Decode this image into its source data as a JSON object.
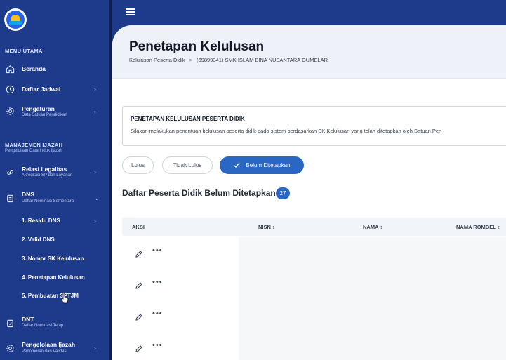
{
  "sidebar": {
    "section_main": "MENU UTAMA",
    "items_main": [
      {
        "label": "Beranda",
        "sub": ""
      },
      {
        "label": "Daftar Jadwal",
        "sub": ""
      },
      {
        "label": "Pengaturan",
        "sub": "Data Satuan Pendidikan"
      }
    ],
    "section_ijazah": "MANAJEMEN IJAZAH",
    "section_ijazah_sub": "Pengelolaan Data Induk Ijazah",
    "items_ijazah": [
      {
        "label": "Relasi Legalitas",
        "sub": "Akreditasi SP dan Layanan"
      },
      {
        "label": "DNS",
        "sub": "Daftar Nominasi Sementara"
      },
      {
        "label": "DNT",
        "sub": "Daftar Nominasi Tetap"
      },
      {
        "label": "Pengelolaan Ijazah",
        "sub": "Penomoran dan Validasi"
      }
    ],
    "dns_subitems": [
      "1. Residu DNS",
      "2. Valid DNS",
      "3. Nomor SK Kelulusan",
      "4. Penetapan Kelulusan",
      "5. Pembuatan SPTJM"
    ]
  },
  "header": {
    "title": "Penetapan Kelulusan",
    "breadcrumb": [
      "Kelulusan Peserta Didik",
      "(69899341) SMK ISLAM BINA NUSANTARA GUMELAR"
    ]
  },
  "info": {
    "title": "PENETAPAN KELULUSAN PESERTA DIDIK",
    "text": "Silakan melakukan penentuan kelulusan peserta didik pada sistem berdasarkan SK Kelulusan yang telah ditetapkan oleh Satuan Pen"
  },
  "filters": {
    "lulus": "Lulus",
    "tidak_lulus": "Tidak Lulus",
    "belum": "Belum Ditetapkan"
  },
  "list": {
    "title": "Daftar Peserta Didik Belum Ditetapkan",
    "count": "27"
  },
  "table": {
    "columns": [
      "AKSI",
      "NISN",
      "NAMA",
      "NAMA ROMBEL"
    ],
    "sort_glyph": "↕",
    "row_count": 4,
    "more_glyph": "•••"
  },
  "colors": {
    "sidebar": "#1e3a8a",
    "accent": "#2a66c4"
  }
}
